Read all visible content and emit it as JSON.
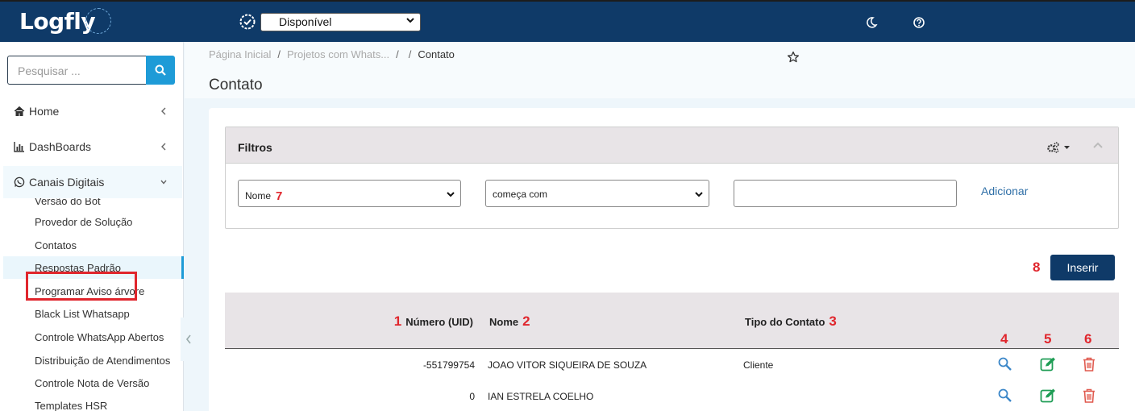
{
  "app": {
    "logo": "Logfly"
  },
  "topbar": {
    "status_value": "Disponível",
    "icons": [
      "gear-badge-icon",
      "moon-icon",
      "help-icon"
    ]
  },
  "sidebar": {
    "search_placeholder": "Pesquisar ...",
    "nav": [
      {
        "label": "Home",
        "icon": "home-icon"
      },
      {
        "label": "DashBoards",
        "icon": "bar-chart-icon"
      },
      {
        "label": "Canais Digitais",
        "icon": "whatsapp-icon"
      }
    ],
    "sub_items": [
      "Versão do Bot",
      "Provedor de Solução",
      "Contatos",
      "Respostas Padrão",
      "Programar Aviso árvore",
      "Black List Whatsapp",
      "Controle WhatsApp Abertos",
      "Distribuição de Atendimentos",
      "Controle Nota de Versão",
      "Templates HSR"
    ]
  },
  "breadcrumb": {
    "home": "Página Inicial",
    "projects": "Projetos com Whats...",
    "sep": "/",
    "current": "Contato"
  },
  "page": {
    "title": "Contato"
  },
  "filters": {
    "title": "Filtros",
    "field_value": "Nome",
    "field_mark": "7",
    "operator_value": "começa com",
    "text_value": "",
    "add_label": "Adicionar"
  },
  "insert": {
    "label": "Inserir",
    "mark": "8"
  },
  "table": {
    "columns": [
      {
        "mark": "1",
        "label": "Número (UID)"
      },
      {
        "mark": "2",
        "label": "Nome"
      },
      {
        "mark": "3",
        "label": "Tipo do Contato"
      }
    ],
    "action_marks": [
      "4",
      "5",
      "6"
    ],
    "rows": [
      {
        "numero": "-551799754",
        "nome": "JOAO VITOR SIQUEIRA DE SOUZA",
        "tipo": "Cliente"
      },
      {
        "numero": "0",
        "nome": "IAN ESTRELA COELHO",
        "tipo": ""
      }
    ]
  },
  "colors": {
    "primary": "#0f3a68",
    "accent": "#1e9bd7",
    "annotation": "#e0262d",
    "edit": "#1f9d55",
    "delete": "#e05a4f"
  }
}
